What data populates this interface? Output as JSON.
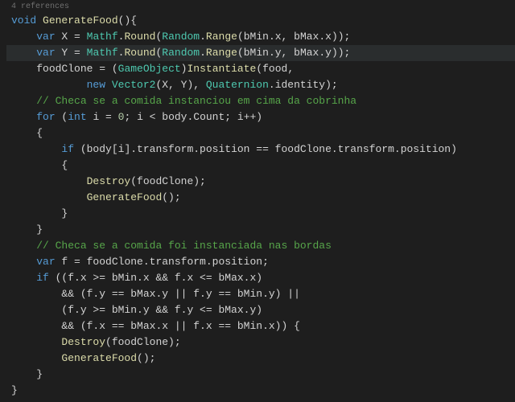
{
  "references": "4 references",
  "lines": [
    {
      "indent": 0,
      "hl": false,
      "type": "sig",
      "tokens": [
        {
          "c": "kw",
          "t": "void"
        },
        {
          "c": "op",
          "t": " "
        },
        {
          "c": "fn",
          "t": "GenerateFood"
        },
        {
          "c": "op",
          "t": "(){"
        }
      ]
    },
    {
      "indent": 1,
      "hl": false,
      "type": "stmt",
      "tokens": [
        {
          "c": "kw",
          "t": "var"
        },
        {
          "c": "op",
          "t": " X = "
        },
        {
          "c": "type",
          "t": "Mathf"
        },
        {
          "c": "op",
          "t": "."
        },
        {
          "c": "fn",
          "t": "Round"
        },
        {
          "c": "op",
          "t": "("
        },
        {
          "c": "type",
          "t": "Random"
        },
        {
          "c": "op",
          "t": "."
        },
        {
          "c": "fn",
          "t": "Range"
        },
        {
          "c": "op",
          "t": "(bMin.x, bMax.x));"
        }
      ]
    },
    {
      "indent": 1,
      "hl": true,
      "type": "stmt",
      "tokens": [
        {
          "c": "kw",
          "t": "var"
        },
        {
          "c": "op",
          "t": " Y = "
        },
        {
          "c": "type",
          "t": "Mathf"
        },
        {
          "c": "op",
          "t": "."
        },
        {
          "c": "fn",
          "t": "Round"
        },
        {
          "c": "op",
          "t": "("
        },
        {
          "c": "type",
          "t": "Random"
        },
        {
          "c": "op",
          "t": "."
        },
        {
          "c": "fn",
          "t": "Range"
        },
        {
          "c": "op",
          "t": "(bMin.y, bMax.y));"
        }
      ]
    },
    {
      "indent": 1,
      "hl": false,
      "type": "stmt",
      "tokens": [
        {
          "c": "id",
          "t": "foodClone"
        },
        {
          "c": "op",
          "t": " = ("
        },
        {
          "c": "type",
          "t": "GameObject"
        },
        {
          "c": "op",
          "t": ")"
        },
        {
          "c": "fn",
          "t": "Instantiate"
        },
        {
          "c": "op",
          "t": "(food,"
        }
      ]
    },
    {
      "indent": 3,
      "hl": false,
      "type": "stmt",
      "tokens": [
        {
          "c": "kw",
          "t": "new"
        },
        {
          "c": "op",
          "t": " "
        },
        {
          "c": "type",
          "t": "Vector2"
        },
        {
          "c": "op",
          "t": "(X, Y), "
        },
        {
          "c": "type",
          "t": "Quaternion"
        },
        {
          "c": "op",
          "t": ".identity);"
        }
      ]
    },
    {
      "indent": 1,
      "hl": false,
      "type": "comment",
      "tokens": [
        {
          "c": "cmt",
          "t": "// Checa se a comida instanciou em cima da cobrinha"
        }
      ]
    },
    {
      "indent": 1,
      "hl": false,
      "type": "stmt",
      "tokens": [
        {
          "c": "kw",
          "t": "for"
        },
        {
          "c": "op",
          "t": " ("
        },
        {
          "c": "kw",
          "t": "int"
        },
        {
          "c": "op",
          "t": " i = "
        },
        {
          "c": "num",
          "t": "0"
        },
        {
          "c": "op",
          "t": "; i < body.Count; i++)"
        }
      ]
    },
    {
      "indent": 1,
      "hl": false,
      "type": "brace",
      "tokens": [
        {
          "c": "op",
          "t": "{"
        }
      ]
    },
    {
      "indent": 2,
      "hl": false,
      "type": "stmt",
      "tokens": [
        {
          "c": "kw",
          "t": "if"
        },
        {
          "c": "op",
          "t": " (body[i].transform.position == foodClone.transform.position)"
        }
      ]
    },
    {
      "indent": 2,
      "hl": false,
      "type": "brace",
      "tokens": [
        {
          "c": "op",
          "t": "{"
        }
      ]
    },
    {
      "indent": 3,
      "hl": false,
      "type": "stmt",
      "tokens": [
        {
          "c": "fn",
          "t": "Destroy"
        },
        {
          "c": "op",
          "t": "(foodClone);"
        }
      ]
    },
    {
      "indent": 3,
      "hl": false,
      "type": "stmt",
      "tokens": [
        {
          "c": "fn",
          "t": "GenerateFood"
        },
        {
          "c": "op",
          "t": "();"
        }
      ]
    },
    {
      "indent": 2,
      "hl": false,
      "type": "brace",
      "tokens": [
        {
          "c": "op",
          "t": "}"
        }
      ]
    },
    {
      "indent": 1,
      "hl": false,
      "type": "brace",
      "tokens": [
        {
          "c": "op",
          "t": "}"
        }
      ]
    },
    {
      "indent": 1,
      "hl": false,
      "type": "comment",
      "tokens": [
        {
          "c": "cmt",
          "t": "// Checa se a comida foi instanciada nas bordas"
        }
      ]
    },
    {
      "indent": 1,
      "hl": false,
      "type": "stmt",
      "tokens": [
        {
          "c": "kw",
          "t": "var"
        },
        {
          "c": "op",
          "t": " f = foodClone.transform.position;"
        }
      ]
    },
    {
      "indent": 1,
      "hl": false,
      "type": "stmt",
      "tokens": [
        {
          "c": "kw",
          "t": "if"
        },
        {
          "c": "op",
          "t": " ((f.x >= bMin.x && f.x <= bMax.x)"
        }
      ]
    },
    {
      "indent": 2,
      "hl": false,
      "type": "stmt",
      "tokens": [
        {
          "c": "op",
          "t": "&& (f.y == bMax.y || f.y == bMin.y) ||"
        }
      ]
    },
    {
      "indent": 2,
      "hl": false,
      "type": "stmt",
      "tokens": [
        {
          "c": "op",
          "t": "(f.y >= bMin.y && f.y <= bMax.y)"
        }
      ]
    },
    {
      "indent": 2,
      "hl": false,
      "type": "stmt",
      "tokens": [
        {
          "c": "op",
          "t": "&& (f.x == bMax.x || f.x == bMin.x)) {"
        }
      ]
    },
    {
      "indent": 2,
      "hl": false,
      "type": "stmt",
      "tokens": [
        {
          "c": "fn",
          "t": "Destroy"
        },
        {
          "c": "op",
          "t": "(foodClone);"
        }
      ]
    },
    {
      "indent": 2,
      "hl": false,
      "type": "stmt",
      "tokens": [
        {
          "c": "fn",
          "t": "GenerateFood"
        },
        {
          "c": "op",
          "t": "();"
        }
      ]
    },
    {
      "indent": 1,
      "hl": false,
      "type": "brace",
      "tokens": [
        {
          "c": "op",
          "t": "}"
        }
      ]
    },
    {
      "indent": 0,
      "hl": false,
      "type": "brace",
      "tokens": [
        {
          "c": "op",
          "t": "}"
        }
      ]
    }
  ]
}
